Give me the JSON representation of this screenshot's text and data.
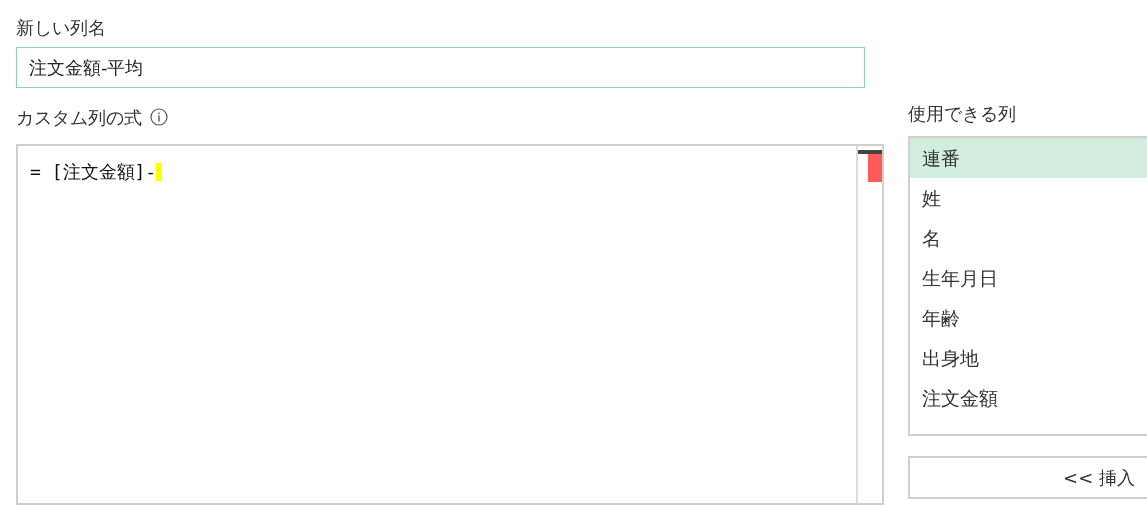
{
  "new_column_name": {
    "label": "新しい列名",
    "value": "注文金額-平均"
  },
  "formula": {
    "label": "カスタム列の式",
    "value": "= [注文金額]-"
  },
  "available_columns": {
    "label": "使用できる列",
    "items": [
      {
        "label": "連番",
        "selected": true
      },
      {
        "label": "姓",
        "selected": false
      },
      {
        "label": "名",
        "selected": false
      },
      {
        "label": "生年月日",
        "selected": false
      },
      {
        "label": "年齢",
        "selected": false
      },
      {
        "label": "出身地",
        "selected": false
      },
      {
        "label": "注文金額",
        "selected": false
      }
    ]
  },
  "insert_button": {
    "label": "<< 挿入"
  }
}
